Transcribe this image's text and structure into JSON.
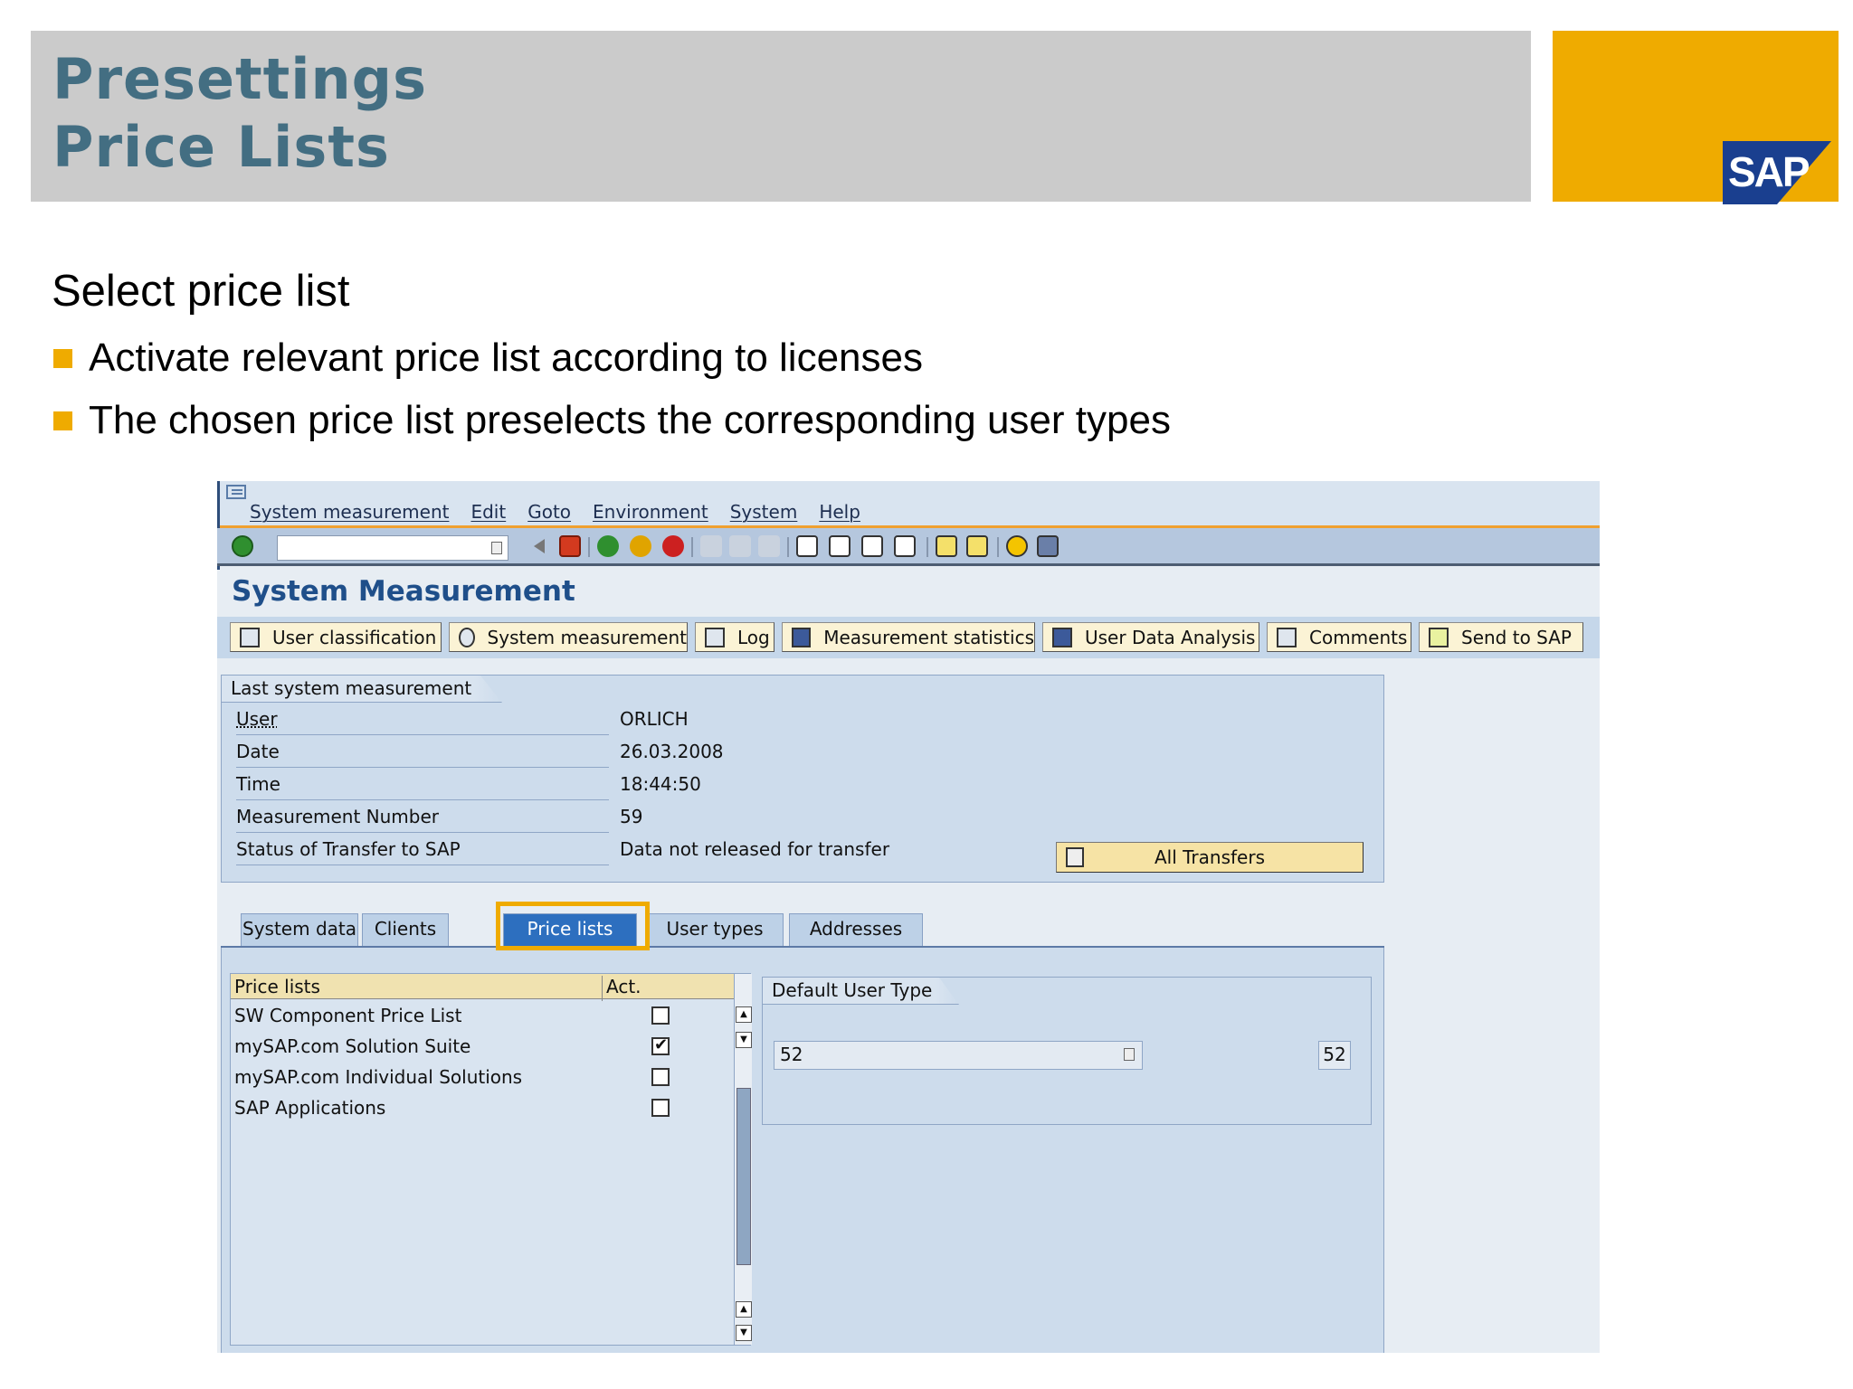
{
  "slide": {
    "title_line1": "Presettings",
    "title_line2": "Price Lists",
    "logo_text": "SAP",
    "heading": "Select price list",
    "bullets": [
      "Activate relevant price list according to licenses",
      "The chosen price list preselects the corresponding user types"
    ]
  },
  "sap": {
    "menu": [
      "System measurement",
      "Edit",
      "Goto",
      "Environment",
      "System",
      "Help"
    ],
    "app_title": "System Measurement",
    "app_toolbar": [
      "User classification",
      "System measurement",
      "Log",
      "Measurement statistics",
      "User Data Analysis",
      "Comments",
      "Send to SAP"
    ],
    "last_measurement": {
      "title": "Last system measurement",
      "fields": [
        {
          "label": "User",
          "value": "ORLICH"
        },
        {
          "label": "Date",
          "value": "26.03.2008"
        },
        {
          "label": "Time",
          "value": "18:44:50"
        },
        {
          "label": "Measurement Number",
          "value": "59"
        },
        {
          "label": "Status of Transfer to SAP",
          "value": "Data not released for transfer"
        }
      ],
      "all_transfers_label": "All Transfers"
    },
    "tabs": [
      "System data",
      "Clients",
      "Price lists",
      "User types",
      "Addresses"
    ],
    "active_tab": "Price lists",
    "price_lists": {
      "col_name": "Price lists",
      "col_act": "Act.",
      "rows": [
        {
          "name": "SW Component Price List",
          "active": false
        },
        {
          "name": "mySAP.com Solution Suite",
          "active": true
        },
        {
          "name": "mySAP.com Individual Solutions",
          "active": false
        },
        {
          "name": "SAP Applications",
          "active": false
        }
      ]
    },
    "default_user_type": {
      "title": "Default User Type",
      "input_value": "52",
      "display_value": "52"
    },
    "colors": {
      "accent": "#efab00",
      "title_blue": "#436e82",
      "active_tab": "#2d6fbf"
    }
  }
}
